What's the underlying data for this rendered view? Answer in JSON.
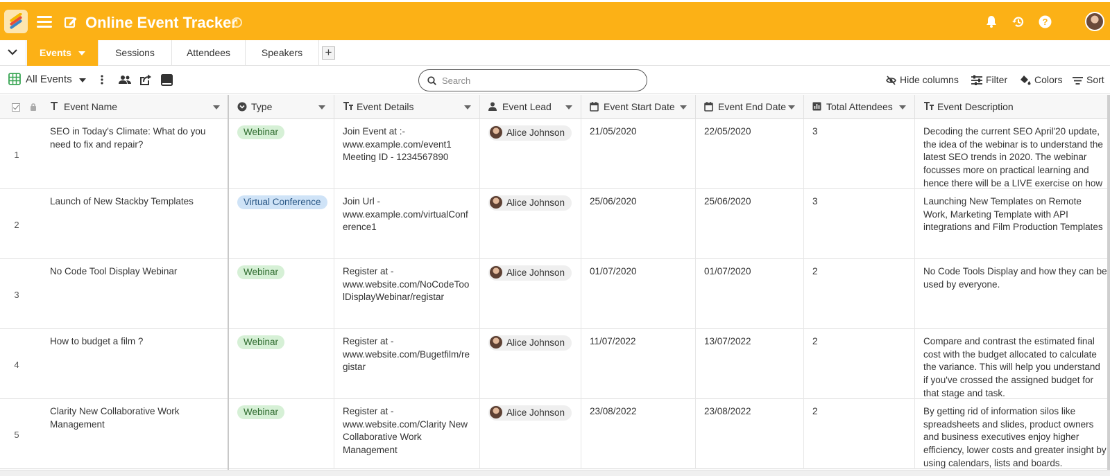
{
  "app": {
    "title": "Online Event Tracker",
    "accent": "#fcb116",
    "icons": [
      "logo-icon",
      "menu-icon",
      "edit-icon",
      "info-icon",
      "bell-icon",
      "history-icon",
      "help-icon",
      "avatar"
    ]
  },
  "tabs": {
    "items": [
      {
        "label": "Events",
        "active": true
      },
      {
        "label": "Sessions",
        "active": false
      },
      {
        "label": "Attendees",
        "active": false
      },
      {
        "label": "Speakers",
        "active": false
      }
    ]
  },
  "toolbar": {
    "view_name": "All Events",
    "search_placeholder": "Search",
    "hide_columns": "Hide columns",
    "filter": "Filter",
    "colors": "Colors",
    "sort": "Sort"
  },
  "columns": [
    {
      "label": "Event Name",
      "icon": "text-icon"
    },
    {
      "label": "Type",
      "icon": "single-select-icon"
    },
    {
      "label": "Event Details",
      "icon": "long-text-icon"
    },
    {
      "label": "Event Lead",
      "icon": "person-icon"
    },
    {
      "label": "Event Start Date",
      "icon": "calendar-icon"
    },
    {
      "label": "Event End Date",
      "icon": "calendar-icon"
    },
    {
      "label": "Total Attendees",
      "icon": "number-icon"
    },
    {
      "label": "Event Description",
      "icon": "long-text-icon"
    }
  ],
  "rows": [
    {
      "num": "1",
      "name": "SEO in Today's Climate: What do you need to fix and repair?",
      "type": "Webinar",
      "details": "Join Event at :- www.example.com/event1 Meeting ID - 1234567890",
      "lead": "Alice Johnson",
      "start": "21/05/2020",
      "end": "22/05/2020",
      "attendees": "3",
      "description": "Decoding the current SEO April'20 update, the idea of the webinar is to understand the latest SEO trends in 2020. The webinar focusses more on practical learning and hence there will be a LIVE exercise on how users can perform their"
    },
    {
      "num": "2",
      "name": "Launch of New Stackby Templates",
      "type": "Virtual Conference",
      "details": "Join Url - www.example.com/virtualConference1",
      "lead": "Alice Johnson",
      "start": "25/06/2020",
      "end": "25/06/2020",
      "attendees": "3",
      "description": "Launching New Templates on Remote Work, Marketing Template with API integrations and Film Production Templates"
    },
    {
      "num": "3",
      "name": "No Code Tool Display Webinar",
      "type": "Webinar",
      "details": "Register at - www.website.com/NoCodeToolDisplayWebinar/registar",
      "lead": "Alice Johnson",
      "start": "01/07/2020",
      "end": "01/07/2020",
      "attendees": "2",
      "description": "No Code Tools Display and how they can be used by everyone."
    },
    {
      "num": "4",
      "name": "How to budget a film ?",
      "type": "Webinar",
      "details": "Register at - www.website.com/Bugetfilm/registar",
      "lead": "Alice Johnson",
      "start": "11/07/2022",
      "end": "13/07/2022",
      "attendees": "2",
      "description": "Compare and contrast the estimated final cost with the budget allocated to calculate the variance. This will help you understand if you've crossed the assigned budget for that stage and task."
    },
    {
      "num": "5",
      "name": "Clarity New Collaborative Work Management",
      "type": "Webinar",
      "details": "Register at - www.website.com/Clarity New Collaborative Work Management",
      "lead": "Alice Johnson",
      "start": "23/08/2022",
      "end": "23/08/2022",
      "attendees": "2",
      "description": "By getting rid of information silos like spreadsheets and slides, product owners and business executives enjoy higher efficiency, lower costs and greater insight by using calendars, lists and boards."
    }
  ],
  "colors": {
    "webinar_pill": "#d6f0d6",
    "virtual_pill": "#cfe3f7"
  }
}
